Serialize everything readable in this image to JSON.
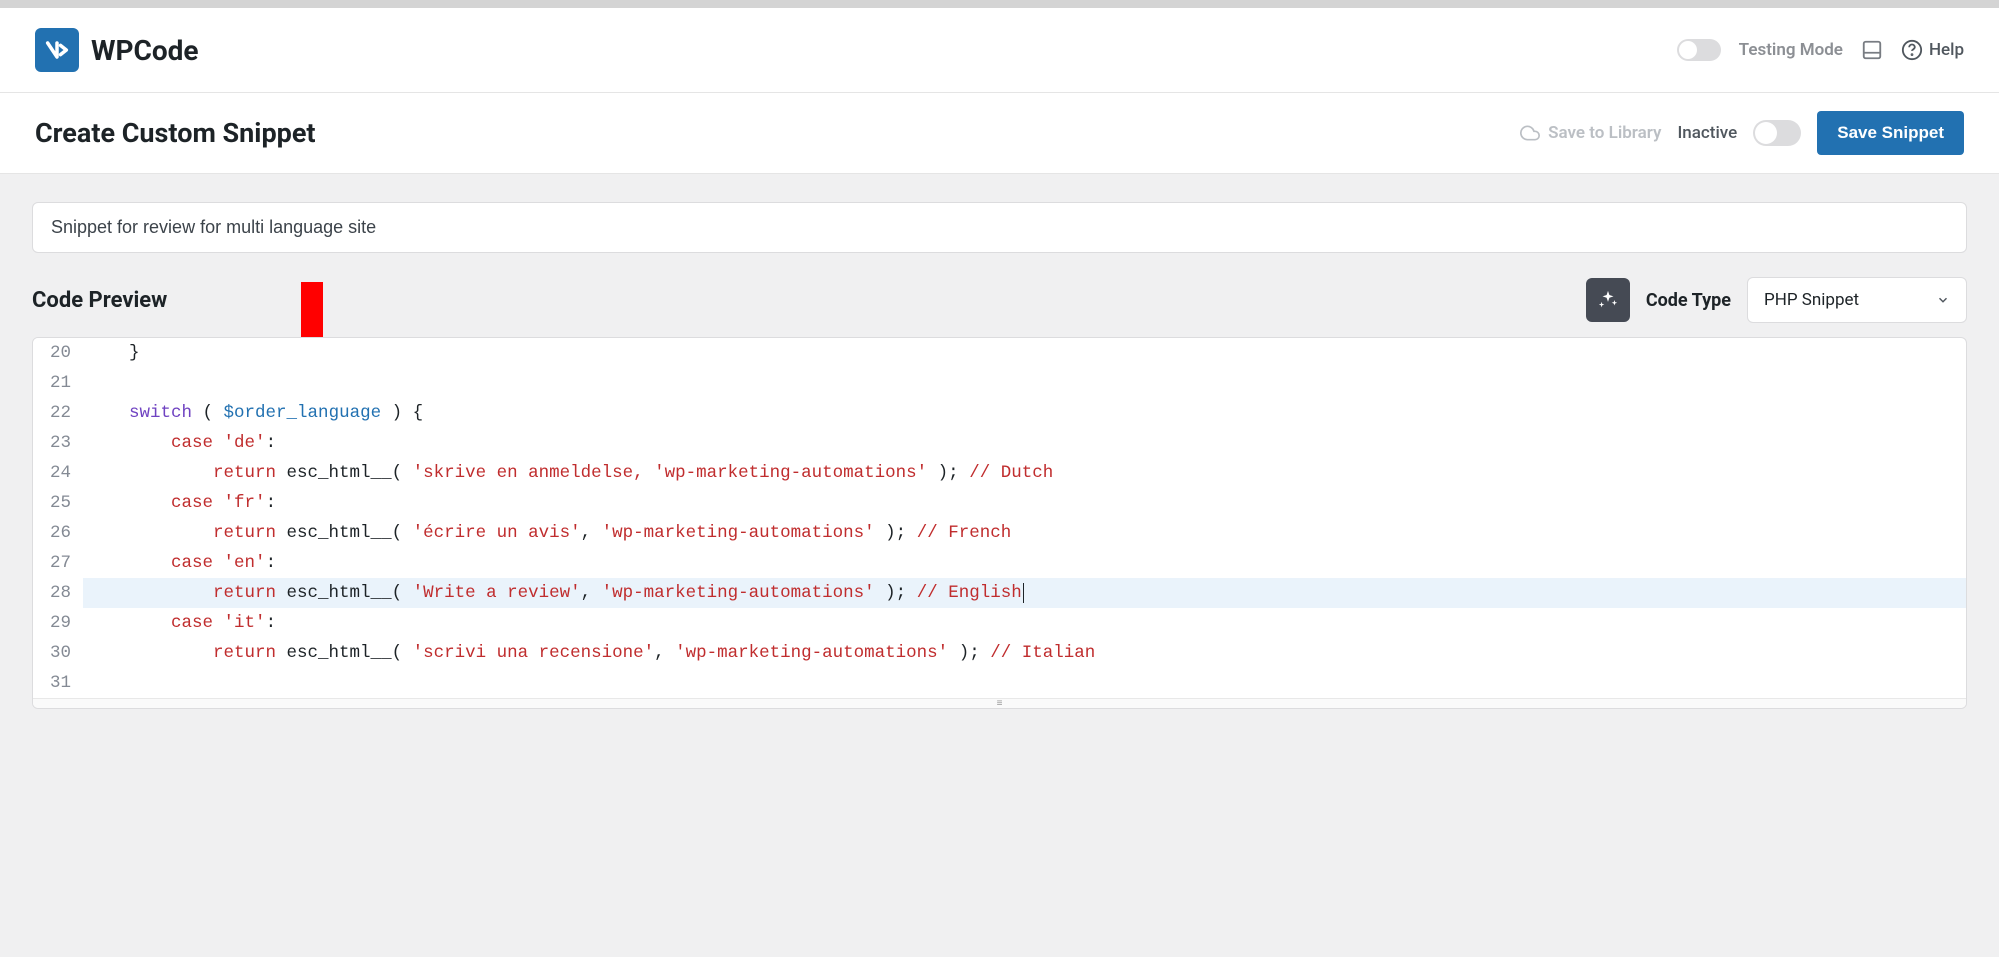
{
  "header": {
    "logo_text": "WPCode",
    "testing_mode_label": "Testing Mode",
    "help_label": "Help"
  },
  "subheader": {
    "page_title": "Create Custom Snippet",
    "save_to_library_label": "Save to Library",
    "inactive_label": "Inactive",
    "save_button_label": "Save Snippet"
  },
  "snippet": {
    "title_value": "Snippet for review for multi language site"
  },
  "preview": {
    "section_title": "Code Preview",
    "code_type_label": "Code Type",
    "code_type_selected": "PHP Snippet"
  },
  "code": {
    "lines": [
      {
        "num": "20",
        "indent": "    ",
        "tokens": [
          {
            "t": "plain",
            "v": "}"
          }
        ]
      },
      {
        "num": "21",
        "indent": "",
        "tokens": []
      },
      {
        "num": "22",
        "indent": "    ",
        "tokens": [
          {
            "t": "keyword",
            "v": "switch"
          },
          {
            "t": "plain",
            "v": " ( "
          },
          {
            "t": "var",
            "v": "$order_language"
          },
          {
            "t": "plain",
            "v": " ) {"
          }
        ]
      },
      {
        "num": "23",
        "indent": "        ",
        "tokens": [
          {
            "t": "case",
            "v": "case"
          },
          {
            "t": "plain",
            "v": " "
          },
          {
            "t": "string",
            "v": "'de'"
          },
          {
            "t": "plain",
            "v": ":"
          }
        ]
      },
      {
        "num": "24",
        "indent": "            ",
        "tokens": [
          {
            "t": "return",
            "v": "return"
          },
          {
            "t": "plain",
            "v": " esc_html__( "
          },
          {
            "t": "string",
            "v": "'skrive en anmeldelse, 'wp-marketing-automations'"
          },
          {
            "t": "plain",
            "v": " ); "
          },
          {
            "t": "comment",
            "v": "// Dutch"
          }
        ]
      },
      {
        "num": "25",
        "indent": "        ",
        "tokens": [
          {
            "t": "case",
            "v": "case"
          },
          {
            "t": "plain",
            "v": " "
          },
          {
            "t": "string",
            "v": "'fr'"
          },
          {
            "t": "plain",
            "v": ":"
          }
        ]
      },
      {
        "num": "26",
        "indent": "            ",
        "tokens": [
          {
            "t": "return",
            "v": "return"
          },
          {
            "t": "plain",
            "v": " esc_html__( "
          },
          {
            "t": "string",
            "v": "'écrire un avis'"
          },
          {
            "t": "plain",
            "v": ", "
          },
          {
            "t": "string",
            "v": "'wp-marketing-automations'"
          },
          {
            "t": "plain",
            "v": " ); "
          },
          {
            "t": "comment",
            "v": "// French"
          }
        ]
      },
      {
        "num": "27",
        "indent": "        ",
        "tokens": [
          {
            "t": "case",
            "v": "case"
          },
          {
            "t": "plain",
            "v": " "
          },
          {
            "t": "string",
            "v": "'en'"
          },
          {
            "t": "plain",
            "v": ":"
          }
        ]
      },
      {
        "num": "28",
        "indent": "            ",
        "highlighted": true,
        "cursor": true,
        "tokens": [
          {
            "t": "return",
            "v": "return"
          },
          {
            "t": "plain",
            "v": " esc_html__( "
          },
          {
            "t": "string",
            "v": "'Write a review'"
          },
          {
            "t": "plain",
            "v": ", "
          },
          {
            "t": "string",
            "v": "'wp-marketing-automations'"
          },
          {
            "t": "plain",
            "v": " ); "
          },
          {
            "t": "comment",
            "v": "// English"
          }
        ]
      },
      {
        "num": "29",
        "indent": "        ",
        "tokens": [
          {
            "t": "case",
            "v": "case"
          },
          {
            "t": "plain",
            "v": " "
          },
          {
            "t": "string",
            "v": "'it'"
          },
          {
            "t": "plain",
            "v": ":"
          }
        ]
      },
      {
        "num": "30",
        "indent": "            ",
        "tokens": [
          {
            "t": "return",
            "v": "return"
          },
          {
            "t": "plain",
            "v": " esc_html__( "
          },
          {
            "t": "string",
            "v": "'scrivi una recensione'"
          },
          {
            "t": "plain",
            "v": ", "
          },
          {
            "t": "string",
            "v": "'wp-marketing-automations'"
          },
          {
            "t": "plain",
            "v": " ); "
          },
          {
            "t": "comment",
            "v": "// Italian"
          }
        ]
      },
      {
        "num": "31",
        "indent": "",
        "tokens": []
      }
    ]
  },
  "annotations": {
    "arrow_down_color": "#ff0000",
    "arrow_left_color": "#ff0000"
  }
}
